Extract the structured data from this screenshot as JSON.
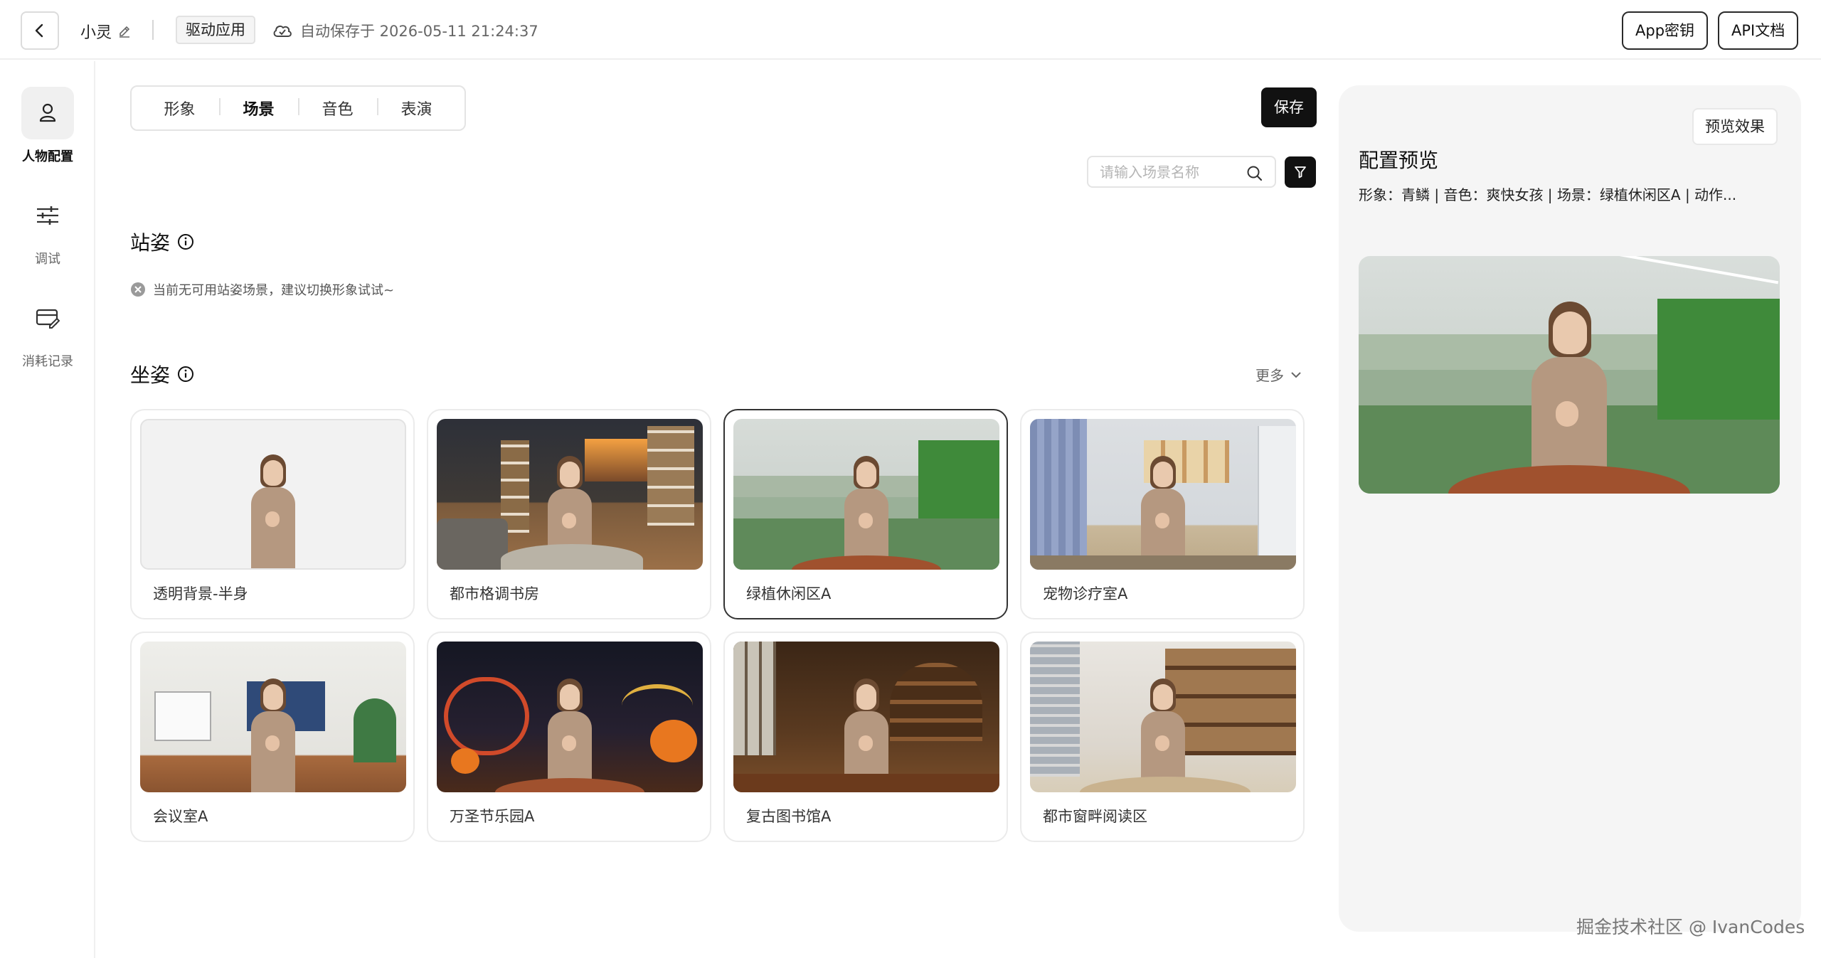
{
  "header": {
    "app_name": "小灵",
    "tag": "驱动应用",
    "autosave": "自动保存于 2026-05-11 21:24:37",
    "app_key_label": "App密钥",
    "api_doc_label": "API文档"
  },
  "sidebar": {
    "items": [
      {
        "label": "人物配置",
        "icon": "person-icon",
        "active": true
      },
      {
        "label": "调试",
        "icon": "sliders-icon",
        "active": false
      },
      {
        "label": "消耗记录",
        "icon": "card-edit-icon",
        "active": false
      }
    ]
  },
  "main": {
    "tabs": [
      {
        "label": "形象",
        "active": false
      },
      {
        "label": "场景",
        "active": true
      },
      {
        "label": "音色",
        "active": false
      },
      {
        "label": "表演",
        "active": false
      }
    ],
    "save_label": "保存",
    "search": {
      "placeholder": "请输入场景名称",
      "value": ""
    },
    "standing": {
      "title": "站姿",
      "notice": "当前无可用站姿场景，建议切换形象试试~"
    },
    "sitting": {
      "title": "坐姿",
      "more_label": "更多",
      "scenes": [
        {
          "label": "透明背景-半身",
          "selected": false
        },
        {
          "label": "都市格调书房",
          "selected": false
        },
        {
          "label": "绿植休闲区A",
          "selected": true
        },
        {
          "label": "宠物诊疗室A",
          "selected": false
        },
        {
          "label": "会议室A",
          "selected": false
        },
        {
          "label": "万圣节乐园A",
          "selected": false
        },
        {
          "label": "复古图书馆A",
          "selected": false
        },
        {
          "label": "都市窗畔阅读区",
          "selected": false
        }
      ]
    }
  },
  "preview": {
    "button_label": "预览效果",
    "title": "配置预览",
    "summary": "形象：青鳞 | 音色：爽快女孩 | 场景：绿植休闲区A | 动作..."
  },
  "watermark": "掘金技术社区 @ IvanCodes",
  "colors": {
    "accent": "#111111",
    "panel_bg": "#f5f5f5",
    "border": "#e4e4e4"
  }
}
